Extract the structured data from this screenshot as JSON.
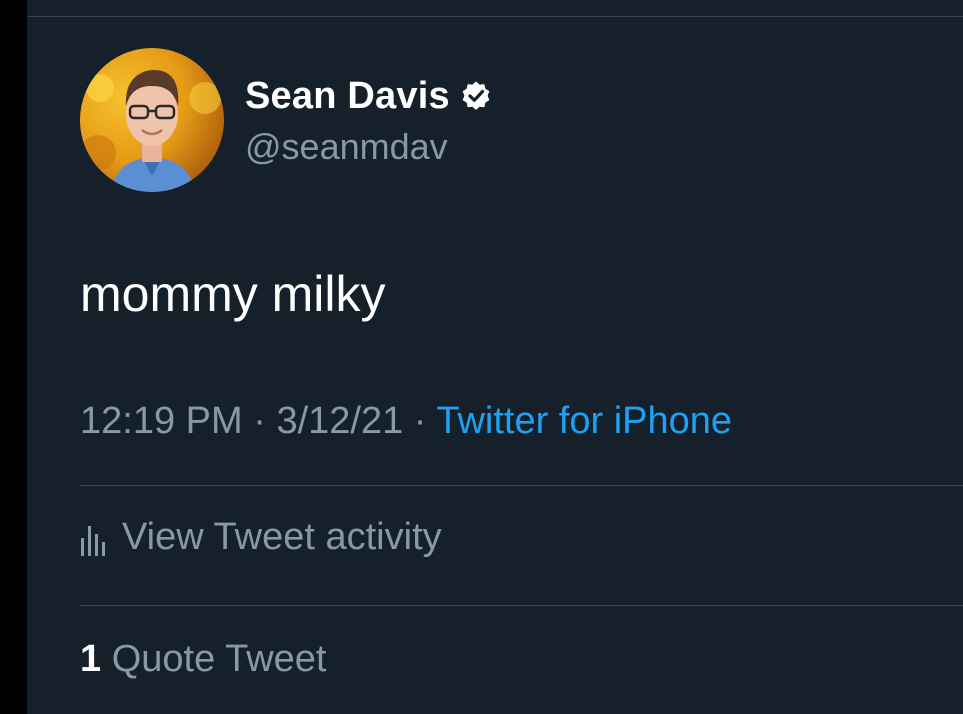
{
  "colors": {
    "background": "#15202b",
    "outer_background": "#000000",
    "primary_text": "#ffffff",
    "secondary_text": "#8899a6",
    "link": "#1da1f2",
    "divider": "#38444d"
  },
  "author": {
    "display_name": "Sean Davis",
    "handle": "@seanmdav",
    "verified_icon": "verified-badge-icon",
    "avatar_icon": "profile-photo"
  },
  "tweet": {
    "text": "mommy milky",
    "time": "12:19 PM",
    "separator": "·",
    "date": "3/12/21",
    "source": "Twitter for iPhone"
  },
  "activity": {
    "icon": "bar-chart-icon",
    "label": "View Tweet activity"
  },
  "stats": {
    "quote_count": "1",
    "quote_label": "Quote Tweet"
  }
}
